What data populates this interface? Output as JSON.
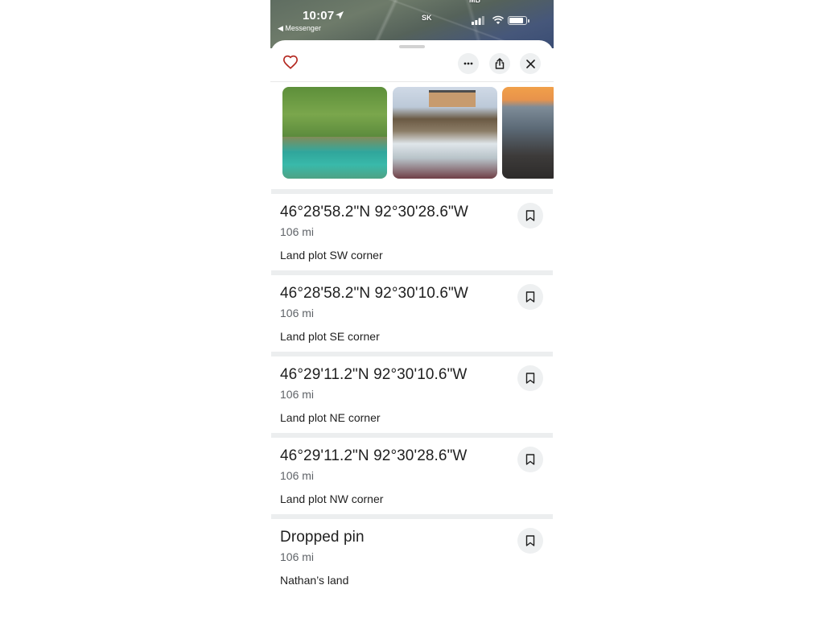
{
  "status_bar": {
    "time": "10:07",
    "back_app": "◀ Messenger"
  },
  "map": {
    "labels": [
      "SK",
      "MB"
    ]
  },
  "header": {
    "favorite_icon": "heart-outline-icon",
    "more_icon": "ellipsis-icon",
    "share_icon": "share-icon",
    "close_icon": "close-icon"
  },
  "photos": [
    {
      "name": "photo-cove-green-water"
    },
    {
      "name": "photo-house-on-rocky-coast"
    },
    {
      "name": "photo-sunset-rocks"
    }
  ],
  "places": [
    {
      "title": "46°28'58.2\"N 92°30'28.6\"W",
      "distance": "106 mi",
      "description": "Land plot SW corner"
    },
    {
      "title": "46°28'58.2\"N 92°30'10.6\"W",
      "distance": "106 mi",
      "description": "Land plot SE corner"
    },
    {
      "title": "46°29'11.2\"N 92°30'10.6\"W",
      "distance": "106 mi",
      "description": "Land plot NE corner"
    },
    {
      "title": "46°29'11.2\"N 92°30'28.6\"W",
      "distance": "106 mi",
      "description": "Land plot NW corner"
    },
    {
      "title": "Dropped pin",
      "distance": "106 mi",
      "description": "Nathan’s land"
    }
  ],
  "colors": {
    "accent_heart": "#b3261e",
    "button_bg": "#eef0f1",
    "separator": "#eceeef"
  }
}
